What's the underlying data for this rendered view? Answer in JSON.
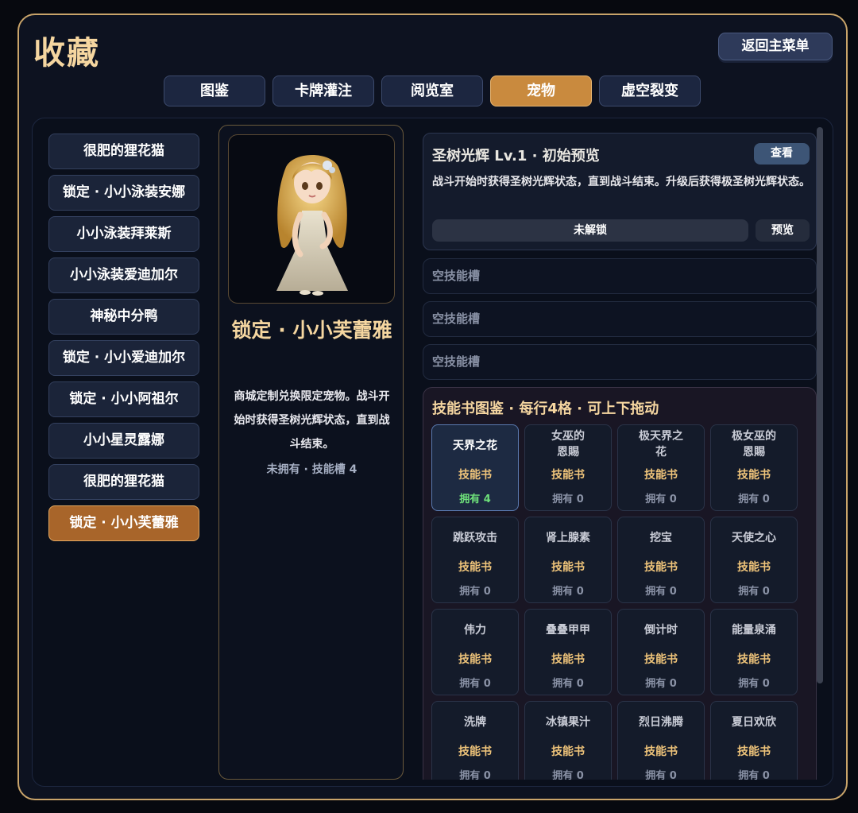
{
  "header": {
    "title": "收藏",
    "back_label": "返回主菜单"
  },
  "tabs": [
    {
      "label": "图鉴",
      "active": false
    },
    {
      "label": "卡牌灌注",
      "active": false
    },
    {
      "label": "阅览室",
      "active": false
    },
    {
      "label": "宠物",
      "active": true
    },
    {
      "label": "虚空裂变",
      "active": false
    }
  ],
  "pets": [
    {
      "label": "很肥的狸花猫"
    },
    {
      "label": "锁定 · 小小泳装安娜"
    },
    {
      "label": "小小泳装拜莱斯"
    },
    {
      "label": "小小泳装爱迪加尔"
    },
    {
      "label": "神秘中分鸭"
    },
    {
      "label": "锁定 · 小小爱迪加尔"
    },
    {
      "label": "锁定 · 小小阿祖尔"
    },
    {
      "label": "小小星灵露娜"
    },
    {
      "label": "很肥的狸花猫"
    },
    {
      "label": "锁定 · 小小芙蕾雅"
    }
  ],
  "detail": {
    "name": "锁定 · 小小芙蕾雅",
    "description": "商城定制兑换限定宠物。战斗开始时获得圣树光辉状态，直到战斗结束。",
    "status": "未拥有 · 技能槽 4"
  },
  "skill": {
    "title": "圣树光辉 Lv.1 · 初始预览",
    "view_label": "查看",
    "description": "战斗开始时获得圣树光辉状态，直到战斗结束。升级后获得极圣树光辉状态。",
    "locked_label": "未解锁",
    "preview_label": "预览"
  },
  "empty_slots": [
    "空技能槽",
    "空技能槽",
    "空技能槽"
  ],
  "skillbooks": {
    "title": "技能书图鉴 · 每行4格 · 可上下拖动",
    "items": [
      {
        "name": "天界之花",
        "type": "技能书",
        "owned": "拥有 4"
      },
      {
        "name": "女巫的恩賜",
        "type": "技能书",
        "owned": "拥有 0"
      },
      {
        "name": "极天界之花",
        "type": "技能书",
        "owned": "拥有 0"
      },
      {
        "name": "极女巫的恩賜",
        "type": "技能书",
        "owned": "拥有 0"
      },
      {
        "name": "跳跃攻击",
        "type": "技能书",
        "owned": "拥有 0"
      },
      {
        "name": "肾上腺素",
        "type": "技能书",
        "owned": "拥有 0"
      },
      {
        "name": "挖宝",
        "type": "技能书",
        "owned": "拥有 0"
      },
      {
        "name": "天使之心",
        "type": "技能书",
        "owned": "拥有 0"
      },
      {
        "name": "伟力",
        "type": "技能书",
        "owned": "拥有 0"
      },
      {
        "name": "叠叠甲甲",
        "type": "技能书",
        "owned": "拥有 0"
      },
      {
        "name": "倒计时",
        "type": "技能书",
        "owned": "拥有 0"
      },
      {
        "name": "能量泉涌",
        "type": "技能书",
        "owned": "拥有 0"
      },
      {
        "name": "洗牌",
        "type": "技能书",
        "owned": "拥有 0"
      },
      {
        "name": "冰镇果汁",
        "type": "技能书",
        "owned": "拥有 0"
      },
      {
        "name": "烈日沸腾",
        "type": "技能书",
        "owned": "拥有 0"
      },
      {
        "name": "夏日欢欣",
        "type": "技能书",
        "owned": "拥有 0"
      }
    ]
  },
  "colors": {
    "accent_gold": "#f5d6a0",
    "active_tab": "#c98a3e",
    "owned_green": "#6ee07a"
  }
}
